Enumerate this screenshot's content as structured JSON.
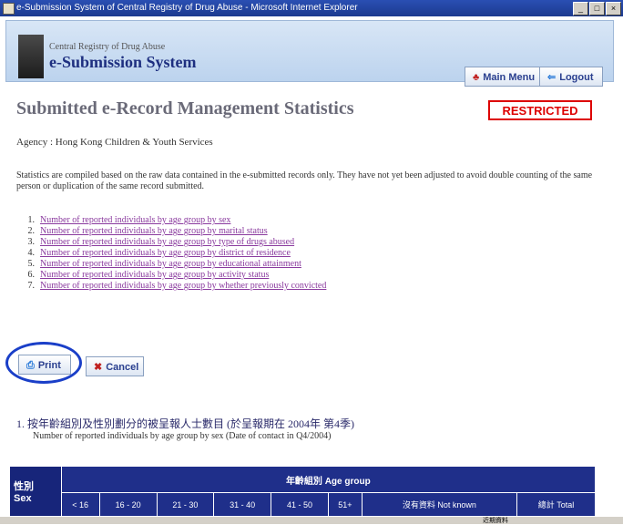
{
  "window": {
    "title": "e-Submission System of Central Registry of Drug Abuse - Microsoft Internet Explorer"
  },
  "header": {
    "sub": "Central Registry of Drug Abuse",
    "system": "e-Submission System",
    "main_menu": "Main Menu",
    "logout": "Logout"
  },
  "page": {
    "title": "Submitted e-Record Management Statistics",
    "restricted": "RESTRICTED",
    "agency": "Agency : Hong Kong Children & Youth Services",
    "note": "Statistics are compiled based on the raw data contained in the e-submitted records only. They have not yet been adjusted to avoid double counting of the same person or duplication of the same record submitted."
  },
  "links": [
    {
      "num": "1.",
      "label": "Number of reported individuals by age group by sex"
    },
    {
      "num": "2.",
      "label": "Number of reported individuals by age group by marital status"
    },
    {
      "num": "3.",
      "label": "Number of reported individuals by age group by type of drugs abused"
    },
    {
      "num": "4.",
      "label": "Number of reported individuals by age group by district of residence"
    },
    {
      "num": "5.",
      "label": "Number of reported individuals by age group by educational attainment"
    },
    {
      "num": "6.",
      "label": "Number of reported individuals by age group by activity status"
    },
    {
      "num": "7.",
      "label": "Number of reported individuals by age group by whether previously convicted"
    }
  ],
  "actions": {
    "print": "Print",
    "cancel": "Cancel"
  },
  "section": {
    "title": "1. 按年齡組別及性別劃分的被呈報人士數目 (於呈報期在 2004年 第4季)",
    "subtitle": "Number of reported individuals by age group by sex (Date of contact in Q4/2004)"
  },
  "table": {
    "sex_zh": "性別",
    "sex_en": "Sex",
    "age_group": "年齡組別 Age group",
    "columns": [
      "< 16",
      "16 - 20",
      "21 - 30",
      "31 - 40",
      "41 - 50",
      "51+",
      "沒有資料 Not known",
      "總計 Total"
    ]
  },
  "status": {
    "zone": "近期資料"
  }
}
